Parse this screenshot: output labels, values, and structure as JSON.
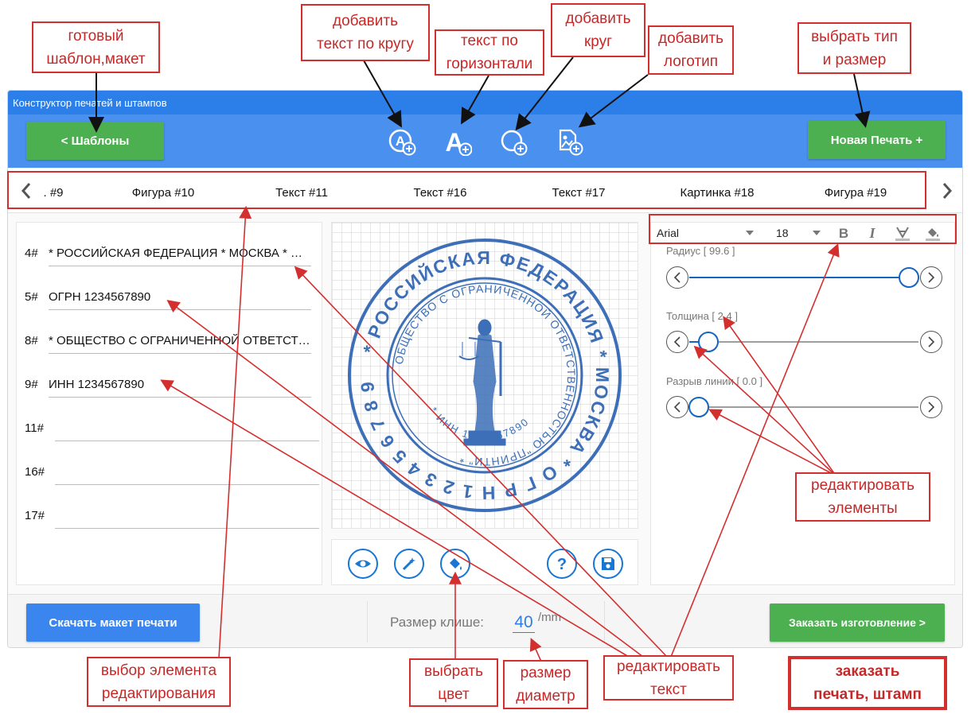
{
  "app": {
    "title": "Конструктор печатей и штампов"
  },
  "toolbar": {
    "templates_label": "<  Шаблоны",
    "new_stamp_label": "Новая Печать +",
    "icons": [
      "add-text-circle-icon",
      "add-text-horizontal-icon",
      "add-circle-icon",
      "add-logo-icon"
    ]
  },
  "tabs": {
    "items": [
      ". #9",
      "Фигура #10",
      "Текст #11",
      "Текст #16",
      "Текст #17",
      "Картинка #18",
      "Фигура #19"
    ]
  },
  "fields": [
    {
      "label": "4#",
      "value": " * РОССИЙСКАЯ ФЕДЕРАЦИЯ  * МОСКВА * ОГРН"
    },
    {
      "label": "5#",
      "value": "ОГРН 1234567890"
    },
    {
      "label": "8#",
      "value": " *  ОБЩЕСТВО  С ОГРАНИЧЕННОЙ ОТВЕТСТВЕННОСТЬЮ"
    },
    {
      "label": "9#",
      "value": "ИНН 1234567890"
    },
    {
      "label": "11#",
      "value": ""
    },
    {
      "label": "16#",
      "value": ""
    },
    {
      "label": "17#",
      "value": ""
    }
  ],
  "stamp": {
    "outer_text": "* РОССИЙСКАЯ ФЕДЕРАЦИЯ * МОСКВА * О Г Р Н 1 2 3 4 5 6 7 8 9 0",
    "inner_text": "ОБЩЕСТВО С ОГРАНИЧЕННОЙ ОТВЕТСТВЕННОСТЬЮ \"ПРИНТИ\" *",
    "inn_text": "* ИНН 1234567890",
    "color": "#3d6fb8"
  },
  "font_toolbar": {
    "font": "Arial",
    "size": "18"
  },
  "sliders": [
    {
      "label": "Радиус [ 99.6 ]",
      "value": 99.6,
      "fraction": 0.96
    },
    {
      "label": "Толщина [ 2.4 ]",
      "value": 2.4,
      "fraction": 0.04
    },
    {
      "label": "Разрыв линии [ 0.0 ]",
      "value": 0.0,
      "fraction": 0.0
    }
  ],
  "bottom": {
    "download_label": "Скачать макет печати",
    "size_label": "Размер клише:",
    "size_value": "40",
    "size_unit": "/mm",
    "order_label": "Заказать изготовление >"
  },
  "colors": {
    "accent_blue": "#2c7ee8",
    "toolbar_blue": "#4a90ee",
    "green": "#4caf50",
    "download_blue": "#3b86ee",
    "annotation_red": "#d32f2f"
  },
  "annotations": {
    "template": [
      "готовый",
      "шаблон,макет"
    ],
    "text_circle": [
      "добавить",
      "текст по кругу"
    ],
    "text_horizontal": [
      "текст по",
      "горизонтали"
    ],
    "add_circle": [
      "добавить",
      "круг"
    ],
    "add_logo": [
      "добавить",
      "логотип"
    ],
    "type_size": [
      "выбрать тип",
      "и размер"
    ],
    "edit_elements": [
      "редактировать",
      "элементы"
    ],
    "select_element": [
      "выбор элемента",
      "редактирования"
    ],
    "pick_color": [
      "выбрать",
      "цвет"
    ],
    "diameter": [
      "размер",
      "диаметр"
    ],
    "edit_text": [
      "редактировать",
      "текст"
    ],
    "order": [
      "заказать",
      "печать, штамп"
    ]
  }
}
